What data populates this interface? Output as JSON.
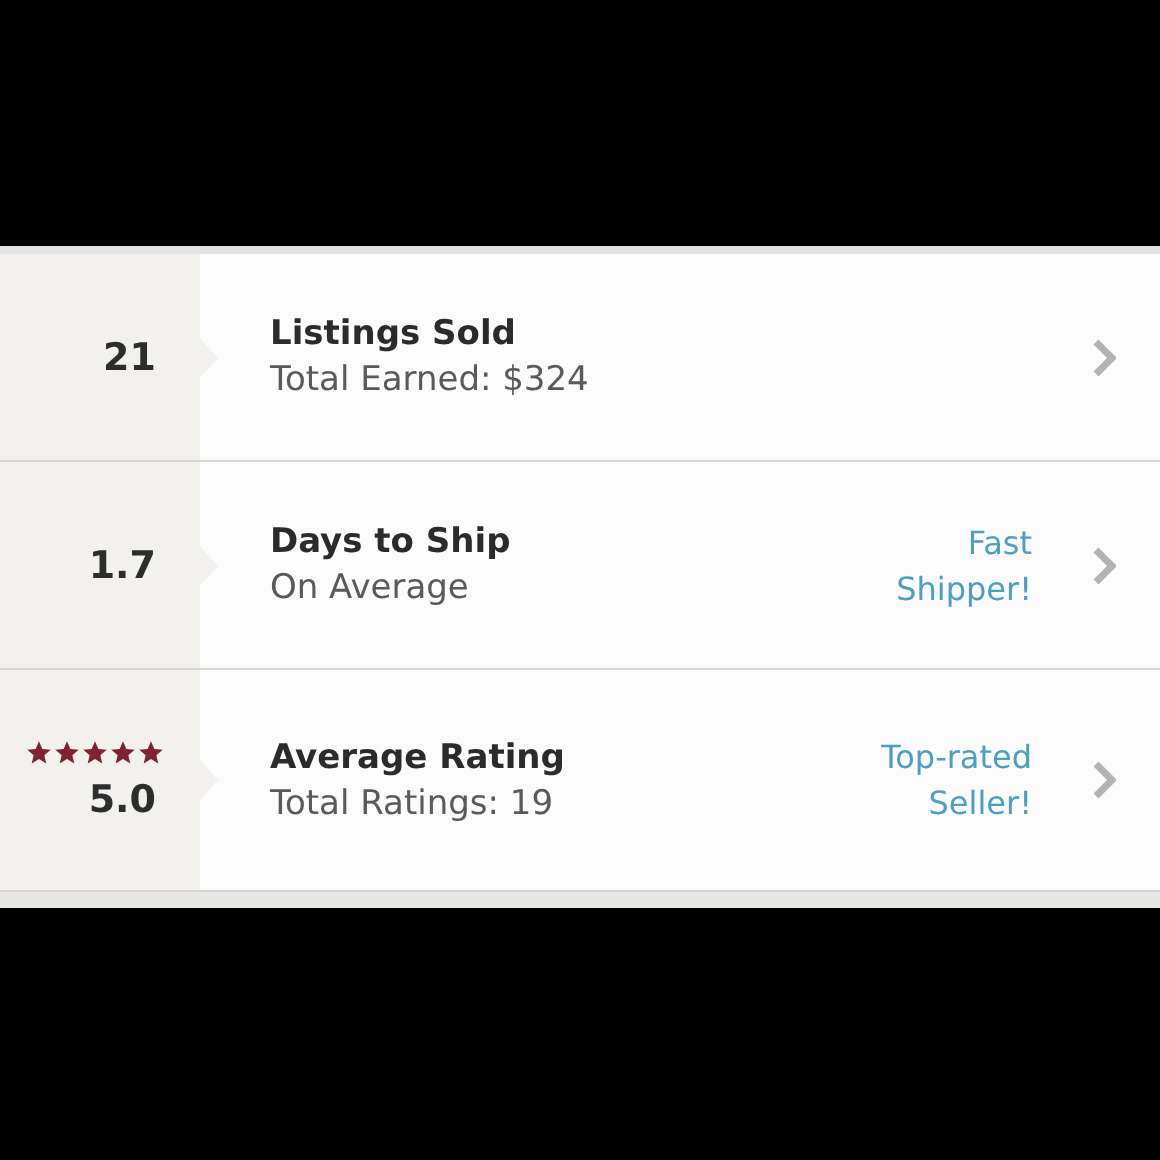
{
  "stats": [
    {
      "value": "21",
      "title": "Listings Sold",
      "subtitle": "Total Earned: $324"
    },
    {
      "value": "1.7",
      "title": "Days to Ship",
      "subtitle": "On Average",
      "badge": "Fast Shipper!"
    },
    {
      "value": "5.0",
      "stars": 5,
      "title": "Average Rating",
      "subtitle": "Total Ratings: 19",
      "badge": "Top-rated Seller!"
    }
  ]
}
